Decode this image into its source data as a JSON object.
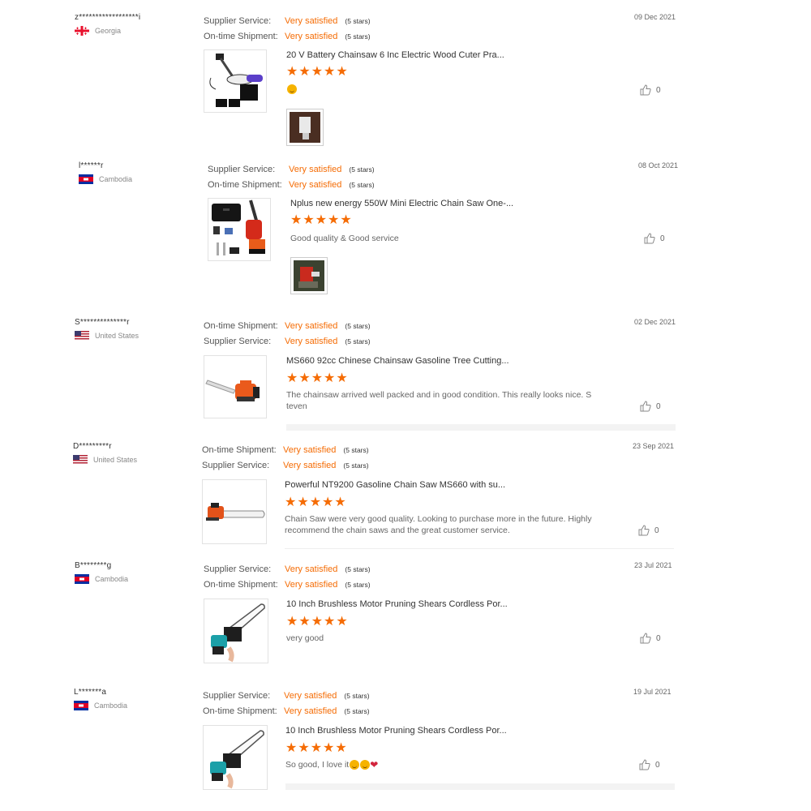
{
  "labels": {
    "supplier": "Supplier Service:",
    "shipment": "On-time Shipment:"
  },
  "colors": {
    "accent": "#f56c05"
  },
  "icons": {
    "like": "thumbs-up-icon",
    "star": "star-icon"
  },
  "reviews": [
    {
      "user": "z******************i",
      "country": "Georgia",
      "flag": "georgia",
      "date": "09 Dec 2021",
      "rating1_label": "Supplier Service:",
      "rating1_value": "Very satisfied",
      "rating1_stars": "(5 stars)",
      "rating2_label": "On-time Shipment:",
      "rating2_value": "Very satisfied",
      "rating2_stars": "(5 stars)",
      "product": "20 V Battery Chainsaw 6 Inc Electric Wood Cuter Pra...",
      "stars": 5,
      "comment": "",
      "emoji": true,
      "likes": "0"
    },
    {
      "user": "l******r",
      "country": "Cambodia",
      "flag": "cambodia",
      "date": "08 Oct 2021",
      "rating1_label": "Supplier Service:",
      "rating1_value": "Very satisfied",
      "rating1_stars": "(5 stars)",
      "rating2_label": "On-time Shipment:",
      "rating2_value": "Very satisfied",
      "rating2_stars": "(5 stars)",
      "product": "Nplus new energy 550W Mini Electric Chain Saw One-...",
      "stars": 5,
      "comment": "Good quality & Good service",
      "likes": "0"
    },
    {
      "user": "S**************r",
      "country": "United States",
      "flag": "usa",
      "date": "02 Dec 2021",
      "rating1_label": "On-time Shipment:",
      "rating1_value": "Very satisfied",
      "rating1_stars": "(5 stars)",
      "rating2_label": "Supplier Service:",
      "rating2_value": "Very satisfied",
      "rating2_stars": "(5 stars)",
      "product": "MS660 92cc Chinese Chainsaw Gasoline Tree Cutting...",
      "stars": 5,
      "comment": "The chainsaw arrived well packed and in good condition.  This really looks nice.  S teven",
      "likes": "0"
    },
    {
      "user": "D*********r",
      "country": "United States",
      "flag": "usa",
      "date": "23 Sep 2021",
      "rating1_label": "On-time Shipment:",
      "rating1_value": "Very satisfied",
      "rating1_stars": "(5 stars)",
      "rating2_label": "Supplier Service:",
      "rating2_value": "Very satisfied",
      "rating2_stars": "(5 stars)",
      "product": "Powerful NT9200 Gasoline Chain Saw MS660 with su...",
      "stars": 5,
      "comment": "Chain Saw were very good quality.  Looking to purchase more in the future. Highly recommend the chain saws and the great customer service.",
      "likes": "0"
    },
    {
      "user": "B********g",
      "country": "Cambodia",
      "flag": "cambodia",
      "date": "23 Jul 2021",
      "rating1_label": "Supplier Service:",
      "rating1_value": "Very satisfied",
      "rating1_stars": "(5 stars)",
      "rating2_label": "On-time Shipment:",
      "rating2_value": "Very satisfied",
      "rating2_stars": "(5 stars)",
      "product": "10 Inch Brushless Motor Pruning Shears Cordless Por...",
      "stars": 5,
      "comment": "very good",
      "likes": "0"
    },
    {
      "user": "L*******a",
      "country": "Cambodia",
      "flag": "cambodia",
      "date": "19 Jul 2021",
      "rating1_label": "Supplier Service:",
      "rating1_value": "Very satisfied",
      "rating1_stars": "(5 stars)",
      "rating2_label": "On-time Shipment:",
      "rating2_value": "Very satisfied",
      "rating2_stars": "(5 stars)",
      "product": "10 Inch Brushless Motor Pruning Shears Cordless Por...",
      "stars": 5,
      "comment": "So good, I love it",
      "emoji_trail": true,
      "likes": "0"
    }
  ]
}
